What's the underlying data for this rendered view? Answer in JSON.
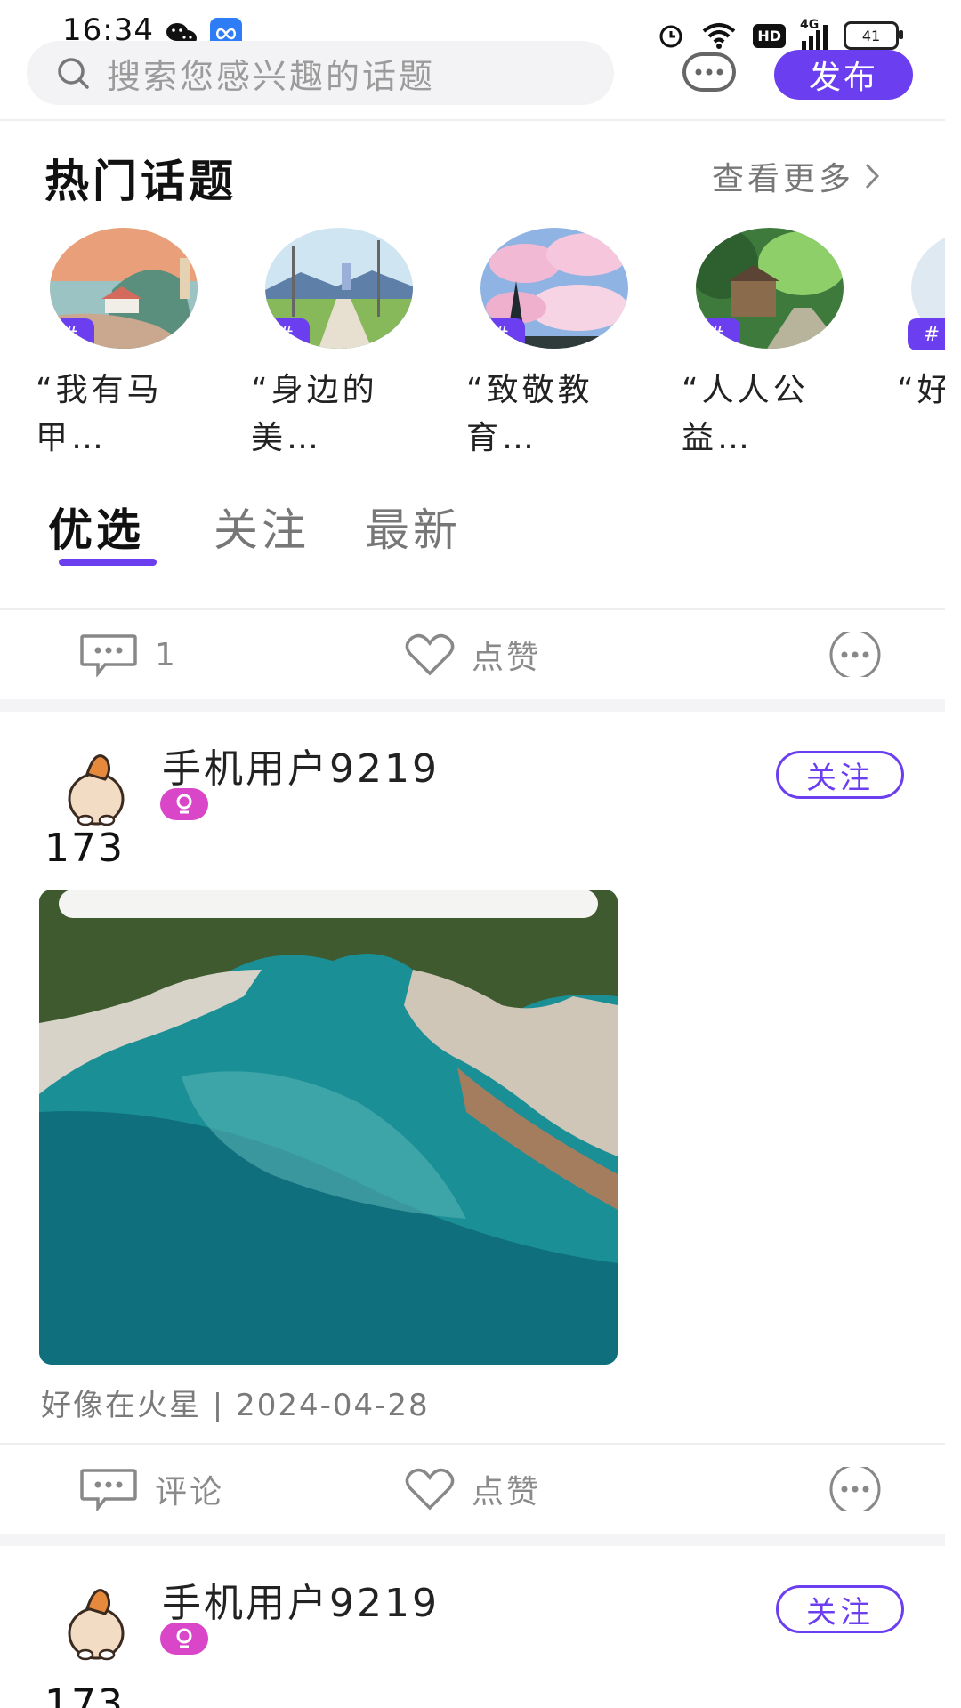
{
  "status_bar": {
    "time": "16:34",
    "hd_badge": "HD",
    "network": "4G",
    "battery": "41"
  },
  "search": {
    "placeholder": "搜索您感兴趣的话题"
  },
  "header": {
    "publish_label": "发布"
  },
  "hot_topics": {
    "title": "热门话题",
    "see_more": "查看更多",
    "hash_symbol": "#",
    "items": [
      {
        "name": "“我有马甲…"
      },
      {
        "name": "“身边的美…"
      },
      {
        "name": "“致敬教育…"
      },
      {
        "name": "“人人公益…"
      },
      {
        "name": "“好"
      }
    ]
  },
  "tabs": [
    {
      "label": "优选"
    },
    {
      "label": "关注"
    },
    {
      "label": "最新"
    }
  ],
  "action_bars": [
    {
      "comment": "1",
      "like": "点赞"
    },
    {
      "comment": "评论",
      "like": "点赞"
    }
  ],
  "posts": [
    {
      "username": "手机用户9219",
      "follow_label": "关注",
      "text": "173",
      "meta": "好像在火星 | 2024-04-28"
    },
    {
      "username": "手机用户9219",
      "follow_label": "关注",
      "text": "173"
    }
  ],
  "colors": {
    "accent": "#6b3ff0",
    "gender_badge": "#d946c7"
  }
}
